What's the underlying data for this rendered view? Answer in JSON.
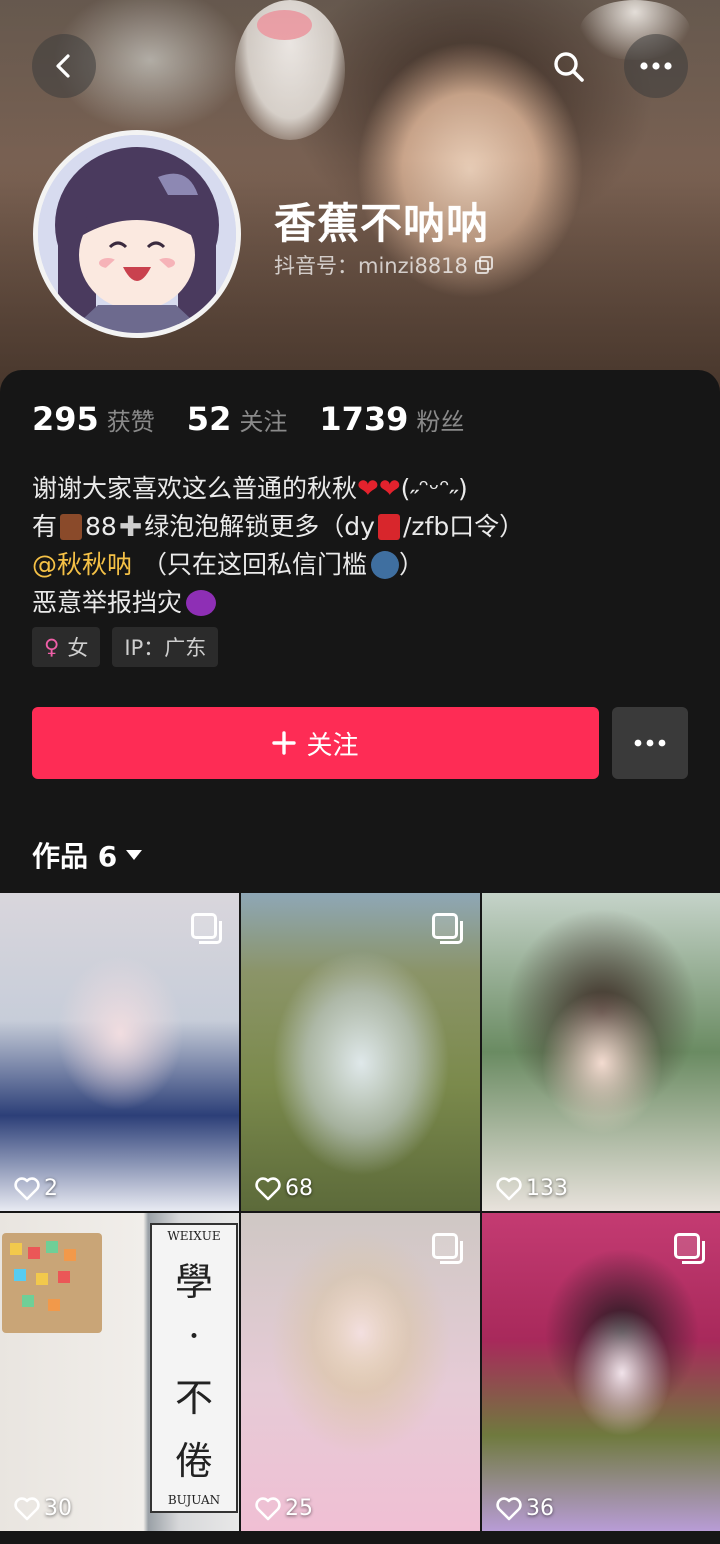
{
  "profile": {
    "nickname": "香蕉不呐呐",
    "douyin_id": "抖音号：minzi8818"
  },
  "stats": [
    {
      "value": "295",
      "label": "获赞"
    },
    {
      "value": "52",
      "label": "关注"
    },
    {
      "value": "1739",
      "label": "粉丝"
    }
  ],
  "bio": {
    "line1": "谢谢大家喜欢这么普通的秋秋",
    "line1_tail": "(˶ᵔᵕᵔ˶)",
    "line2_a": "有",
    "line2_b": "88",
    "line2_c": "绿泡泡解锁更多（dy",
    "line2_d": "/zfb口令）",
    "line3_mention": "@秋秋呐",
    "line3_rest": "（只在这回私信门槛",
    "line3_close": "）",
    "line4": "恶意举报挡灾"
  },
  "tags": {
    "gender": "女",
    "ip": "IP：广东"
  },
  "actions": {
    "follow_label": "关注"
  },
  "works": {
    "title": "作品 6"
  },
  "videos": [
    {
      "likes": "2",
      "multi": true
    },
    {
      "likes": "68",
      "multi": true
    },
    {
      "likes": "133",
      "multi": false
    },
    {
      "likes": "30",
      "multi": false
    },
    {
      "likes": "25",
      "multi": true
    },
    {
      "likes": "36",
      "multi": true
    }
  ],
  "video4_sign": {
    "chars": [
      "學",
      "·",
      "不",
      "倦"
    ],
    "small1": "WEIXUE",
    "small2": "BUJUAN"
  },
  "colors": {
    "accent": "#fe2c55",
    "mention": "#f5c146",
    "background": "#161616"
  },
  "icons": [
    "back-icon",
    "search-icon",
    "more-icon",
    "copy-icon",
    "plus-icon",
    "caret-down-icon",
    "heart-icon",
    "multi-image-icon",
    "female-icon"
  ]
}
